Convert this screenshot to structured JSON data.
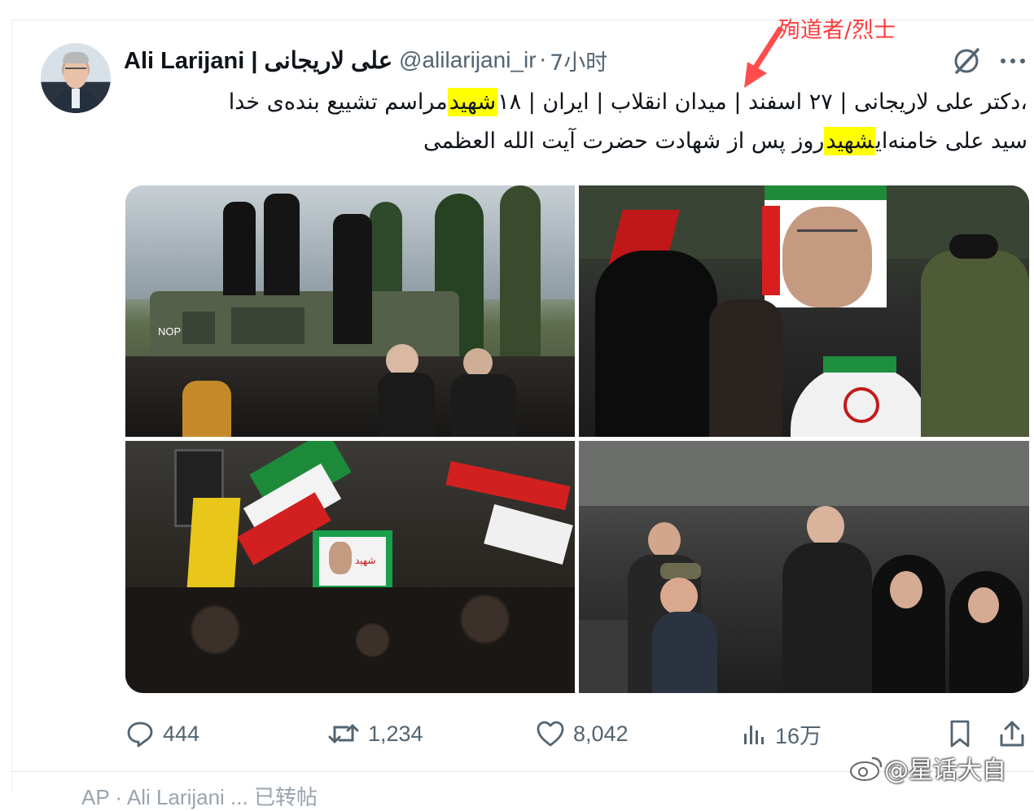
{
  "tweet": {
    "author_name": "Ali Larijani | علی لاریجانی",
    "handle": "@alilarijani_ir",
    "separator": "·",
    "time": "7小时",
    "text_line1": {
      "before": "مراسم تشییع بنده‌ی خدا، ",
      "highlight": "شهید",
      "after": " دکتر علی لاریجانی | ۲۷ اسفند | میدان انقلاب | ایران | ۱۸"
    },
    "text_line2": {
      "before": "روز پس از شهادت حضرت آیت الله العظمی ",
      "highlight": "شهید",
      "after": " سید علی خامنه‌ای"
    },
    "highlight_color": "#ffff00"
  },
  "annotation": {
    "text": "殉道者/烈士",
    "color": "#ff3b3b"
  },
  "media": {
    "photos": [
      {
        "id": "photo-armored-vehicle",
        "label": "NOP"
      },
      {
        "id": "photo-portrait-crowd",
        "label": ""
      },
      {
        "id": "photo-coffin-procession",
        "label": "شهید"
      },
      {
        "id": "photo-mourners-street",
        "label": ""
      }
    ]
  },
  "actions": {
    "replies": "444",
    "reposts": "1,234",
    "likes": "8,042",
    "views": "16万"
  },
  "watermark": {
    "text": "@星话大自"
  },
  "below_text": "AP · Ali Larijani ... 已转帖"
}
